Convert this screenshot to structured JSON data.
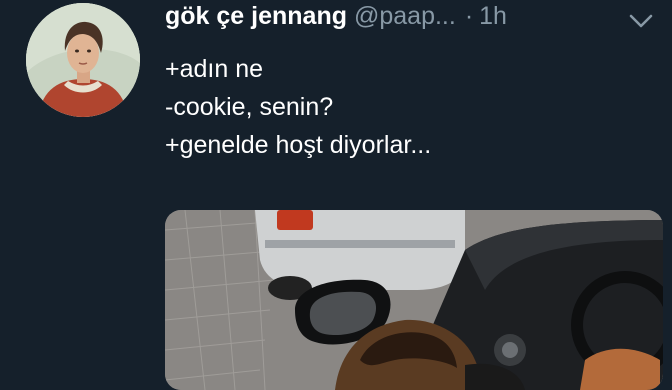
{
  "tweet": {
    "author": {
      "display_name": "gök çe jennang",
      "handle": "@paap...",
      "avatar_icon": "portrait-painting-avatar"
    },
    "separator": "·",
    "timestamp": "1h",
    "menu_icon": "chevron-down-icon",
    "lines": [
      "+adın ne",
      "-cookie, senin?",
      "+genelde hoşt diyorlar..."
    ],
    "media": {
      "kind": "photo",
      "subject": "dog-in-car-window"
    }
  },
  "colors": {
    "background": "#15202b",
    "primary_text": "#ffffff",
    "secondary_text": "#8899a6"
  }
}
